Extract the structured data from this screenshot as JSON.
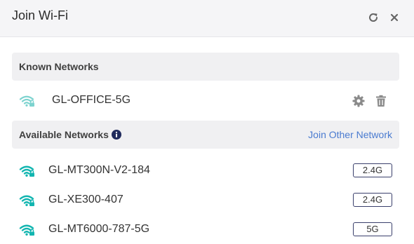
{
  "dialog": {
    "title": "Join Wi-Fi",
    "refresh_icon": "refresh-icon",
    "close_icon": "close-icon"
  },
  "known_networks": {
    "heading": "Known Networks",
    "items": [
      {
        "ssid": "GL-OFFICE-5G",
        "icon": "wifi-lock-icon"
      }
    ]
  },
  "available_networks": {
    "heading": "Available Networks",
    "info_icon": "info-icon",
    "join_other_label": "Join Other Network",
    "items": [
      {
        "ssid": "GL-MT300N-V2-184",
        "band": "2.4G",
        "icon": "wifi-lock-icon"
      },
      {
        "ssid": "GL-XE300-407",
        "band": "2.4G",
        "icon": "wifi-lock-icon"
      },
      {
        "ssid": "GL-MT6000-787-5G",
        "band": "5G",
        "icon": "wifi-lock-icon"
      }
    ]
  },
  "colors": {
    "accent": "#4a7bd0",
    "wifi_known": "#7dd3cf",
    "wifi_available": "#12b5b0",
    "header_bg": "#f5f5f7",
    "section_bg": "#f0f0f2"
  }
}
